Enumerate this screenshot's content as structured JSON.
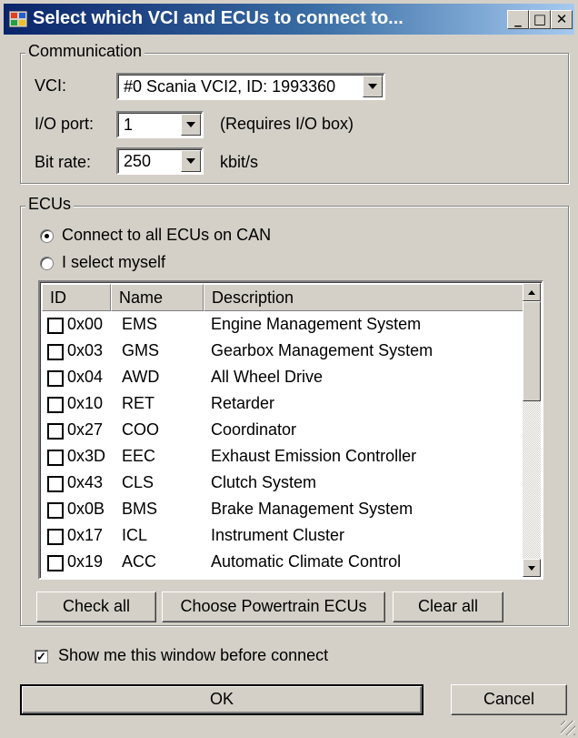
{
  "window": {
    "title": "Select which VCI and ECUs to connect to...",
    "min_glyph": "_",
    "max_glyph": "□",
    "close_glyph": "✕"
  },
  "communication": {
    "group_label": "Communication",
    "vci_label": "VCI:",
    "vci_value": "#0 Scania VCI2, ID: 1993360",
    "io_label": "I/O port:",
    "io_value": "1",
    "io_note": "(Requires I/O box)",
    "bitrate_label": "Bit rate:",
    "bitrate_value": "250",
    "bitrate_unit": "kbit/s"
  },
  "ecus": {
    "group_label": "ECUs",
    "radio_all": "Connect to all ECUs on CAN",
    "radio_self": "I select myself",
    "radio_selected": "all",
    "columns": [
      "ID",
      "Name",
      "Description"
    ],
    "rows": [
      {
        "id": "0x00",
        "name": "EMS",
        "desc": "Engine Management System",
        "checked": false
      },
      {
        "id": "0x03",
        "name": "GMS",
        "desc": "Gearbox Management System",
        "checked": false
      },
      {
        "id": "0x04",
        "name": "AWD",
        "desc": "All Wheel Drive",
        "checked": false
      },
      {
        "id": "0x10",
        "name": "RET",
        "desc": "Retarder",
        "checked": false
      },
      {
        "id": "0x27",
        "name": "COO",
        "desc": "Coordinator",
        "checked": false
      },
      {
        "id": "0x3D",
        "name": "EEC",
        "desc": "Exhaust Emission Controller",
        "checked": false
      },
      {
        "id": "0x43",
        "name": "CLS",
        "desc": "Clutch System",
        "checked": false
      },
      {
        "id": "0x0B",
        "name": "BMS",
        "desc": "Brake Management System",
        "checked": false
      },
      {
        "id": "0x17",
        "name": "ICL",
        "desc": "Instrument Cluster",
        "checked": false
      },
      {
        "id": "0x19",
        "name": "ACC",
        "desc": "Automatic Climate Control",
        "checked": false
      }
    ],
    "check_all": "Check all",
    "choose_powertrain": "Choose Powertrain ECUs",
    "clear_all": "Clear all"
  },
  "show_window": {
    "label": "Show me this window before connect",
    "checked": true
  },
  "ok_label": "OK",
  "cancel_label": "Cancel"
}
